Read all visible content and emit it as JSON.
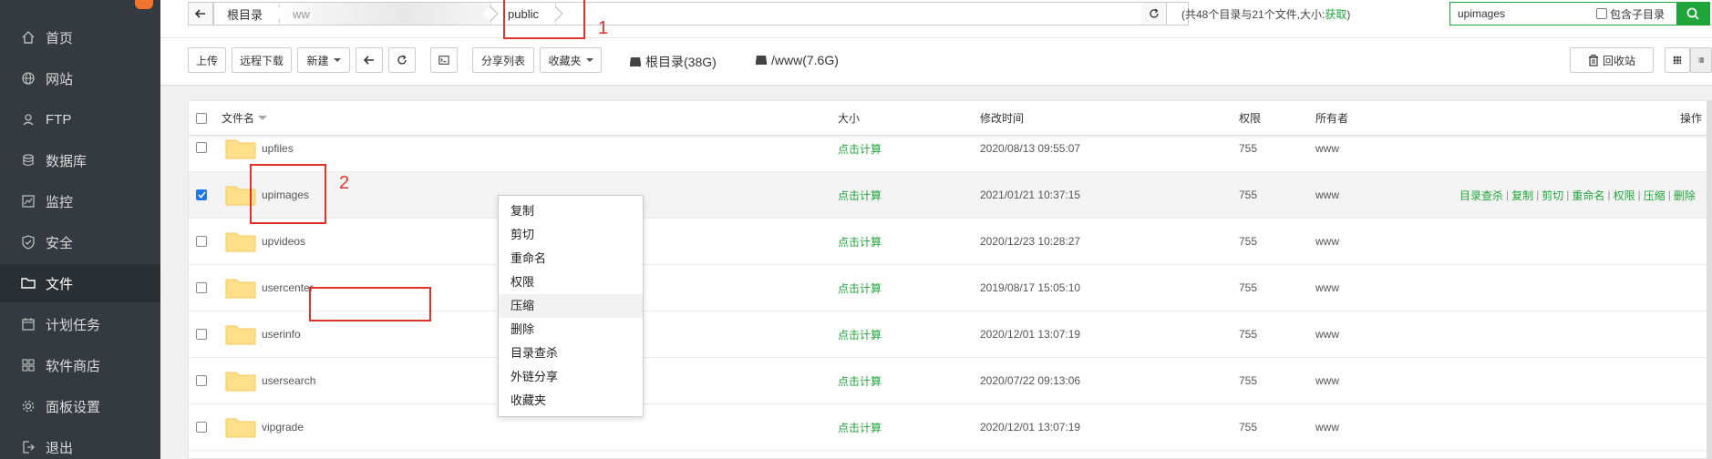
{
  "sidebar": {
    "badge": "",
    "items": [
      {
        "label": "首页",
        "icon": "home-icon"
      },
      {
        "label": "网站",
        "icon": "globe-icon"
      },
      {
        "label": "FTP",
        "icon": "ftp-icon"
      },
      {
        "label": "数据库",
        "icon": "database-icon"
      },
      {
        "label": "监控",
        "icon": "monitor-icon"
      },
      {
        "label": "安全",
        "icon": "shield-icon"
      },
      {
        "label": "文件",
        "icon": "folder-icon"
      },
      {
        "label": "计划任务",
        "icon": "calendar-icon"
      },
      {
        "label": "软件商店",
        "icon": "grid-icon"
      },
      {
        "label": "面板设置",
        "icon": "gear-icon"
      },
      {
        "label": "退出",
        "icon": "logout-icon"
      }
    ],
    "active": "文件"
  },
  "path": {
    "root": "根目录",
    "blurred": "ww",
    "current": "public"
  },
  "stats": {
    "text": "(共48个目录与21个文件,大小:",
    "link": "获取",
    "close": ")"
  },
  "search": {
    "value": "upimages",
    "include_sub_label": "包含子目录"
  },
  "toolbar": {
    "upload": "上传",
    "remote_download": "远程下载",
    "new": "新建",
    "share_list": "分享列表",
    "favorites": "收藏夹",
    "disk_root": "根目录(38G)",
    "disk_www": "/www(7.6G)",
    "recycle": "回收站"
  },
  "table": {
    "headers": {
      "name": "文件名",
      "size": "大小",
      "mtime": "修改时间",
      "perm": "权限",
      "owner": "所有者",
      "ops": "操作"
    },
    "rows": [
      {
        "name": "upfiles",
        "size": "点击计算",
        "mtime": "2020/08/13 09:55:07",
        "perm": "755",
        "owner": "www",
        "checked": false
      },
      {
        "name": "upimages",
        "size": "点击计算",
        "mtime": "2021/01/21 10:37:15",
        "perm": "755",
        "owner": "www",
        "checked": true
      },
      {
        "name": "upvideos",
        "size": "点击计算",
        "mtime": "2020/12/23 10:28:27",
        "perm": "755",
        "owner": "www",
        "checked": false
      },
      {
        "name": "usercenter",
        "size": "点击计算",
        "mtime": "2019/08/17 15:05:10",
        "perm": "755",
        "owner": "www",
        "checked": false
      },
      {
        "name": "userinfo",
        "size": "点击计算",
        "mtime": "2020/12/01 13:07:19",
        "perm": "755",
        "owner": "www",
        "checked": false
      },
      {
        "name": "usersearch",
        "size": "点击计算",
        "mtime": "2020/07/22 09:13:06",
        "perm": "755",
        "owner": "www",
        "checked": false
      },
      {
        "name": "vipgrade",
        "size": "点击计算",
        "mtime": "2020/12/01 13:07:19",
        "perm": "755",
        "owner": "www",
        "checked": false
      }
    ],
    "row_ops": [
      "目录查杀",
      "复制",
      "剪切",
      "重命名",
      "权限",
      "压缩",
      "删除"
    ]
  },
  "context_menu": {
    "items": [
      "复制",
      "剪切",
      "重命名",
      "权限",
      "压缩",
      "删除",
      "目录查杀",
      "外链分享",
      "收藏夹"
    ],
    "highlighted": "压缩"
  },
  "annotations": {
    "one": "1",
    "two": "2"
  },
  "colors": {
    "accent_green": "#20a53a",
    "sidebar_bg": "#343a40",
    "annotation_red": "#e0312b",
    "checkbox_blue": "#1e78e6",
    "folder_yellow": "#ffe08a"
  }
}
